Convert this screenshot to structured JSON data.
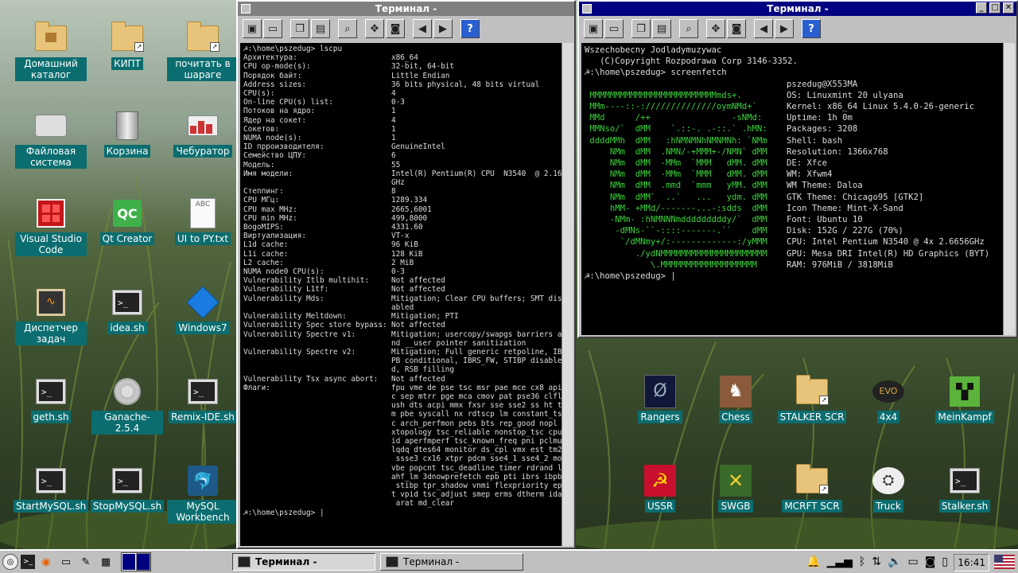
{
  "desktop": {
    "icons_left": [
      {
        "label": "Домашний каталог",
        "icon": "home-folder-icon"
      },
      {
        "label": "КИПТ",
        "icon": "folder-link-icon"
      },
      {
        "label": "почитать в шараге",
        "icon": "folder-link-icon"
      },
      {
        "label": "Файловая система",
        "icon": "drive-icon"
      },
      {
        "label": "Корзина",
        "icon": "trash-icon"
      },
      {
        "label": "Чебуратор",
        "icon": "app-icon"
      },
      {
        "label": "Visual Studio Code",
        "icon": "vscode-icon"
      },
      {
        "label": "Qt Creator",
        "icon": "qt-icon",
        "glyph": "QC"
      },
      {
        "label": "UI to PY.txt",
        "icon": "text-file-icon",
        "glyph": "ABC"
      },
      {
        "label": "Диспетчер задач",
        "icon": "task-manager-icon"
      },
      {
        "label": "idea.sh",
        "icon": "terminal-script-icon"
      },
      {
        "label": "Windows7",
        "icon": "vbox-icon"
      },
      {
        "label": "geth.sh",
        "icon": "terminal-script-icon"
      },
      {
        "label": "Ganache-2.5.4",
        "icon": "gear-icon"
      },
      {
        "label": "Remix-IDE.sh",
        "icon": "terminal-script-icon"
      },
      {
        "label": "StartMySQL.sh",
        "icon": "terminal-script-icon"
      },
      {
        "label": "StopMySQL.sh",
        "icon": "terminal-script-icon"
      },
      {
        "label": "MySQL Workbench",
        "icon": "mysql-icon"
      }
    ],
    "icons_right": [
      {
        "label": "Rangers",
        "icon": "rangers-icon"
      },
      {
        "label": "Chess",
        "icon": "chess-icon"
      },
      {
        "label": "STALKER SCR",
        "icon": "folder-link-icon"
      },
      {
        "label": "4x4",
        "icon": "game-icon"
      },
      {
        "label": "MeinKampf",
        "icon": "minecraft-icon"
      },
      {
        "label": "USSR",
        "icon": "ussr-icon"
      },
      {
        "label": "SWGB",
        "icon": "swgb-icon"
      },
      {
        "label": "MCRFT SCR",
        "icon": "folder-link-icon"
      },
      {
        "label": "Truck",
        "icon": "truck-icon"
      },
      {
        "label": "Stalker.sh",
        "icon": "terminal-script-icon"
      }
    ]
  },
  "window_left": {
    "title": "Терминал -",
    "prompt": "☭:\\home\\pszedug> ",
    "command": "lscpu",
    "rows": [
      [
        "Архитектура:",
        "x86_64"
      ],
      [
        "CPU op-mode(s):",
        "32-bit, 64-bit"
      ],
      [
        "Порядок байт:",
        "Little Endian"
      ],
      [
        "Address sizes:",
        "36 bits physical, 48 bits virtual"
      ],
      [
        "CPU(s):",
        "4"
      ],
      [
        "On-line CPU(s) list:",
        "0-3"
      ],
      [
        "Потоков на ядро:",
        "1"
      ],
      [
        "Ядер на сокет:",
        "4"
      ],
      [
        "Сокетов:",
        "1"
      ],
      [
        "NUMA node(s):",
        "1"
      ],
      [
        "ID прроизводителя:",
        "GenuineIntel"
      ],
      [
        "Семейство ЦПУ:",
        "6"
      ],
      [
        "Модель:",
        "55"
      ],
      [
        "Имя модели:",
        "Intel(R) Pentium(R) CPU  N3540  @ 2.16",
        "GHz"
      ],
      [
        "Степпинг:",
        "8"
      ],
      [
        "CPU МГц:",
        "1289.334"
      ],
      [
        "CPU max MHz:",
        "2665,6001"
      ],
      [
        "CPU min MHz:",
        "499,8000"
      ],
      [
        "BogoMIPS:",
        "4331.60"
      ],
      [
        "Виртуализация:",
        "VT-x"
      ],
      [
        "L1d cache:",
        "96 KiB"
      ],
      [
        "L1i cache:",
        "128 KiB"
      ],
      [
        "L2 cache:",
        "2 MiB"
      ],
      [
        "NUMA node0 CPU(s):",
        "0-3"
      ],
      [
        "Vulnerability Itlb multihit:",
        "Not affected"
      ],
      [
        "Vulnerability L1tf:",
        "Not affected"
      ],
      [
        "Vulnerability Mds:",
        "Mitigation; Clear CPU buffers; SMT dis",
        "abled"
      ],
      [
        "Vulnerability Meltdown:",
        "Mitigation; PTI"
      ],
      [
        "Vulnerability Spec store bypass:",
        "Not affected"
      ],
      [
        "Vulnerability Spectre v1:",
        "Mitigation; usercopy/swapgs barriers a",
        "nd __user pointer sanitization"
      ],
      [
        "Vulnerability Spectre v2:",
        "Mitigation; Full generic retpoline, IB",
        "PB conditional, IBRS_FW, STIBP disable",
        "d, RSB filling"
      ],
      [
        "Vulnerability Tsx async abort:",
        "Not affected"
      ],
      [
        "Флаги:",
        "fpu vme de pse tsc msr pae mce cx8 api",
        "c sep mtrr pge mca cmov pat pse36 clfl",
        "ush dts acpi mmx fxsr sse sse2 ss ht t",
        "m pbe syscall nx rdtscp lm constant_ts",
        "c arch_perfmon pebs bts rep_good nopl",
        "xtopology tsc_reliable nonstop_tsc cpu",
        "id aperfmperf tsc_known_freq pni pclmu",
        "lqdq dtes64 monitor ds_cpl vmx est tm2",
        " ssse3 cx16 xtpr pdcm sse4_1 sse4_2 mo",
        "vbe popcnt tsc_deadline_timer rdrand l",
        "ahf_lm 3dnowprefetch epb pti ibrs ibpb",
        " stibp tpr_shadow vnmi flexpriority ep",
        "t vpid tsc_adjust smep erms dtherm ida",
        " arat md_clear"
      ]
    ]
  },
  "window_right": {
    "title": "Терминал -",
    "banner": [
      "Wszechobecny Jodladymuzywac",
      "   (C)Copyright Rozpodrawa Corp 3146-3352."
    ],
    "prompt": "☭:\\home\\pszedug> ",
    "command": "screenfetch",
    "logo": [
      "",
      " MMMMMMMMMMMMMMMMMMMMMMMMMmds+.",
      " MMm----::-://////////////oymNMd+`",
      " MMd      /++                -sNMd:",
      " MMNso/`  dMM    `.::-. .-::.` .hMN:",
      " ddddMMh  dMM   :hNMNMNhNMNMNh: `NMm",
      "     NMm  dMM  .NMN/-+MMM+-/NMN` dMM",
      "     NMm  dMM  -MMm  `MMM   dMM. dMM",
      "     NMm  dMM  -MMm  `MMM   dMM. dMM",
      "     NMm  dMM  .mmd  `mmm   yMM. dMM",
      "     NMm  dMM`  ..`   ...   ydm. dMM",
      "     hMM- +MMd/-------...-:sdds  dMM",
      "     -NMm- :hNMNNNmdddddddddy/`  dMM",
      "      -dMNs-``-::::-------.``    dMM",
      "       `/dMNmy+/:-------------:/yMMM",
      "          ./ydNMMMMMMMMMMMMMMMMMMMMM",
      "             \\.MMMMMMMMMMMMMMMMMMM"
    ],
    "info": [
      [
        "pszedug@X553MA",
        ""
      ],
      [
        "OS: ",
        "Linuxmint 20 ulyana"
      ],
      [
        "Kernel: ",
        "x86_64 Linux 5.4.0-26-generic"
      ],
      [
        "Uptime: ",
        "1h 0m"
      ],
      [
        "Packages: ",
        "3208"
      ],
      [
        "Shell: ",
        "bash"
      ],
      [
        "Resolution: ",
        "1366x768"
      ],
      [
        "DE: ",
        "Xfce"
      ],
      [
        "WM: ",
        "Xfwm4"
      ],
      [
        "WM Theme: ",
        "Daloa"
      ],
      [
        "GTK Theme: ",
        "Chicago95 [GTK2]"
      ],
      [
        "Icon Theme: ",
        "Mint-X-Sand"
      ],
      [
        "Font: ",
        "Ubuntu 10"
      ],
      [
        "Disk: ",
        "152G / 227G (70%)"
      ],
      [
        "CPU: ",
        "Intel Pentium N3540 @ 4x 2.6656GHz"
      ],
      [
        "GPU: ",
        "Mesa DRI Intel(R) HD Graphics (BYT)"
      ],
      [
        "RAM: ",
        "976MiB / 3818MiB"
      ]
    ]
  },
  "taskbar": {
    "tasks": [
      {
        "label": "Терминал -",
        "active": true
      },
      {
        "label": "Терминал -",
        "active": false
      }
    ],
    "clock": "16:41"
  },
  "colors": {
    "title_active": "#000080",
    "title_inactive": "#808080",
    "label_bg": "#0b6d6f",
    "term_green": "#3bd13b"
  }
}
